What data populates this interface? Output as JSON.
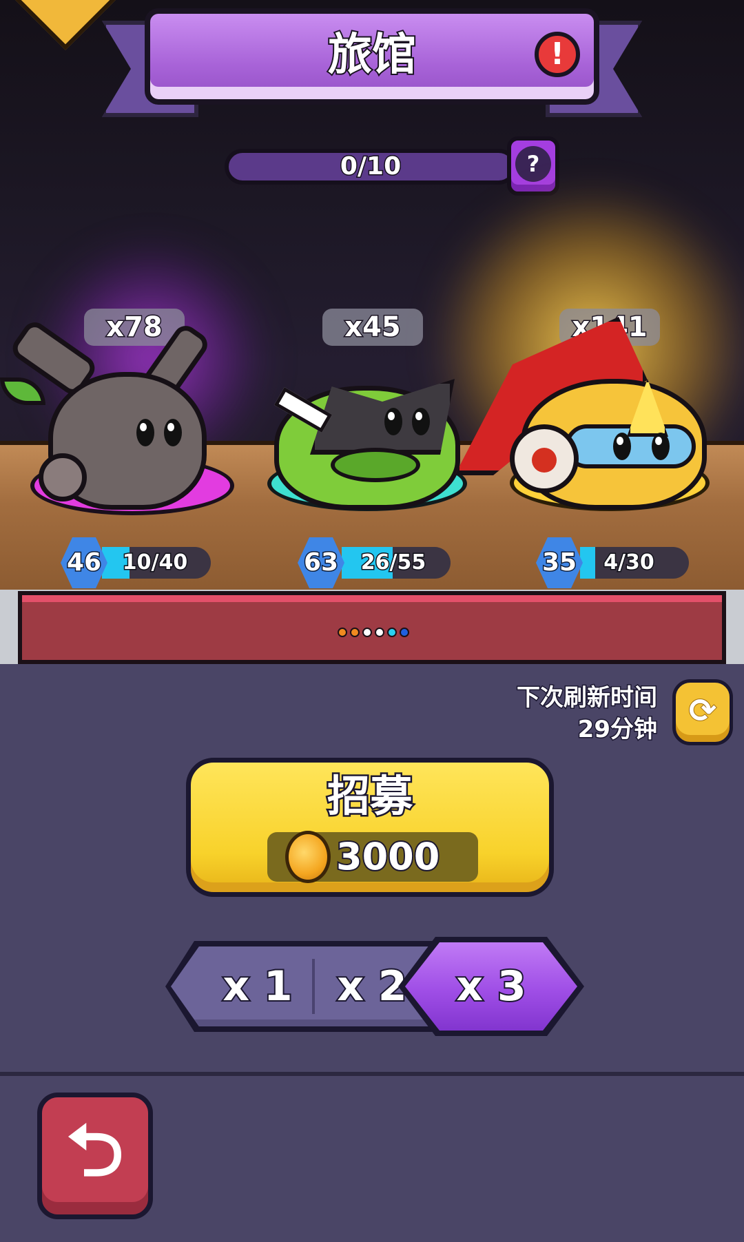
{
  "header": {
    "title": "旅馆",
    "alert_icon": "exclamation-icon",
    "alert_symbol": "!"
  },
  "capacity": {
    "current": 0,
    "max": 10,
    "text": "0/10",
    "help_symbol": "?"
  },
  "monsters": [
    {
      "count": "x78",
      "level": "46",
      "exp": "10/40",
      "exp_fraction": 0.25,
      "rarity_color": "#e23ce0",
      "body_color": "#6f6565"
    },
    {
      "count": "x45",
      "level": "63",
      "exp": "26/55",
      "exp_fraction": 0.47,
      "rarity_color": "#3ee0d0",
      "body_color": "#7fcc3a"
    },
    {
      "count": "x141",
      "level": "35",
      "exp": "4/30",
      "exp_fraction": 0.13,
      "rarity_color": "#ffd23a",
      "body_color": "#f6c43a"
    }
  ],
  "page_dots": [
    "#f08a20",
    "#f08a20",
    "#ffffff",
    "#ffffff",
    "#2ad0f0",
    "#2060e0"
  ],
  "refresh": {
    "label": "下次刷新时间",
    "time": "29分钟",
    "icon": "refresh-icon",
    "symbol": "⟳"
  },
  "recruit": {
    "label": "招募",
    "price": "3000",
    "currency_icon": "gold-coin-icon"
  },
  "multipliers": {
    "options": [
      "x 1",
      "x 2",
      "x 3"
    ],
    "selected": "x 3"
  },
  "back": {
    "icon": "back-arrow-icon",
    "symbol": "⮌"
  },
  "colors": {
    "title_plate": "#a863d8",
    "recruit_button": "#f8d22b",
    "selected_multiplier": "#9f4ee6",
    "back_button": "#c23e52",
    "level_badge": "#3f86e6",
    "exp_fill": "#23c6f0"
  }
}
